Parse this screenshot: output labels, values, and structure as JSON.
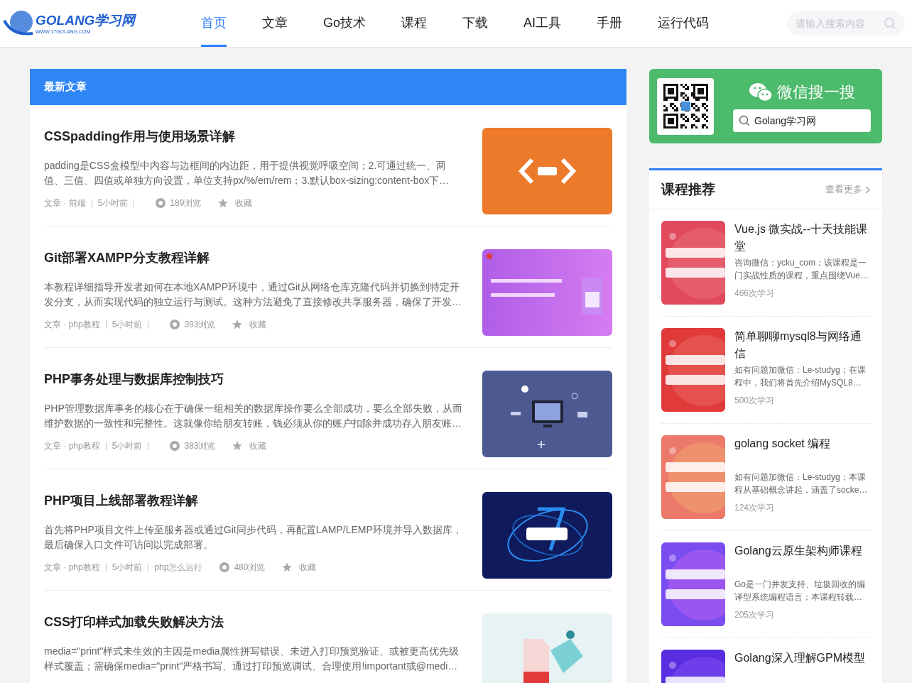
{
  "header": {
    "logo": {
      "name": "GOLANG学习网",
      "url": "WWW.17GOLANG.COM"
    },
    "nav": [
      {
        "label": "首页",
        "selected": true
      },
      {
        "label": "文章",
        "selected": false
      },
      {
        "label": "Go技术",
        "selected": false
      },
      {
        "label": "课程",
        "selected": false
      },
      {
        "label": "下载",
        "selected": false
      },
      {
        "label": "AI工具",
        "selected": false
      },
      {
        "label": "手册",
        "selected": false
      },
      {
        "label": "运行代码",
        "selected": false
      }
    ],
    "search": {
      "placeholder": "请输入搜索内容"
    }
  },
  "articles_panel": {
    "title": "最新文章",
    "articles": [
      {
        "title": "CSSpadding作用与使用场景详解",
        "description": "padding是CSS盒模型中内容与边框间的内边距，用于提供视觉呼吸空间；2.可通过统一、两值、三值、四值或单独方向设置，单位支持px/%/em/rem；3.默认box-sizing:content-box下…",
        "category": "文章 · 前端",
        "time": "5小时前",
        "views": "189浏览",
        "favorite": "收藏"
      },
      {
        "title": "Git部署XAMPP分支教程详解",
        "description": "本教程详细指导开发者如何在本地XAMPP环境中，通过Git从网络仓库克隆代码并切换到特定开发分支，从而实现代码的独立运行与测试。这种方法避免了直接修改共享服务器，确保了开发…",
        "category": "文章 · php教程",
        "time": "5小时前",
        "views": "393浏览",
        "favorite": "收藏"
      },
      {
        "title": "PHP事务处理与数据库控制技巧",
        "description": "PHP管理数据库事务的核心在于确保一组相关的数据库操作要么全部成功，要么全部失败，从而维护数据的一致性和完整性。这就像你给朋友转账，钱必须从你的账户扣除并成功存入朋友账…",
        "category": "文章 · php教程",
        "time": "5小时前",
        "views": "383浏览",
        "favorite": "收藏"
      },
      {
        "title": "PHP项目上线部署教程详解",
        "description": "首先将PHP项目文件上传至服务器或通过Git同步代码，再配置LAMP/LEMP环境并导入数据库，最后确保入口文件可访问以完成部署。",
        "category": "文章 · php教程",
        "time": "5小时前",
        "tag": "php怎么运行",
        "views": "480浏览",
        "favorite": "收藏"
      },
      {
        "title": "CSS打印样式加载失败解决方法",
        "description": "media=\"print\"样式未生效的主因是media属性拼写错误、未进入打印预览验证、或被更高优先级样式覆盖；需确保media=\"print\"严格书写、通过打印预览调试、合理使用!important或@medi…"
      }
    ]
  },
  "wechat": {
    "title": "微信搜一搜",
    "search": "Golang学习网"
  },
  "courses_panel": {
    "title": "课程推荐",
    "more": "查看更多",
    "courses": [
      {
        "title": "Vue.js 微实战--十天技能课堂",
        "description": "咨询微信：ycku_com；该课程是一门实战性质的课程，重点围绕Vue…",
        "learners": "466次学习"
      },
      {
        "title": "简单聊聊mysql8与网络通信",
        "description": "如有问题加微信：Le-studyg；在课程中，我们将首先介绍MySQL8…",
        "learners": "500次学习"
      },
      {
        "title": "golang socket 编程",
        "description": "如有问题加微信：Le-studyg；本课程从基础概念讲起，涵盖了socke…",
        "learners": "124次学习"
      },
      {
        "title": "Golang云原生架构师课程",
        "description": "Go是一门并发支持、垃圾回收的编译型系统编程语言；本课程转载…",
        "learners": "205次学习"
      },
      {
        "title": "Golang深入理解GPM模型"
      }
    ]
  }
}
